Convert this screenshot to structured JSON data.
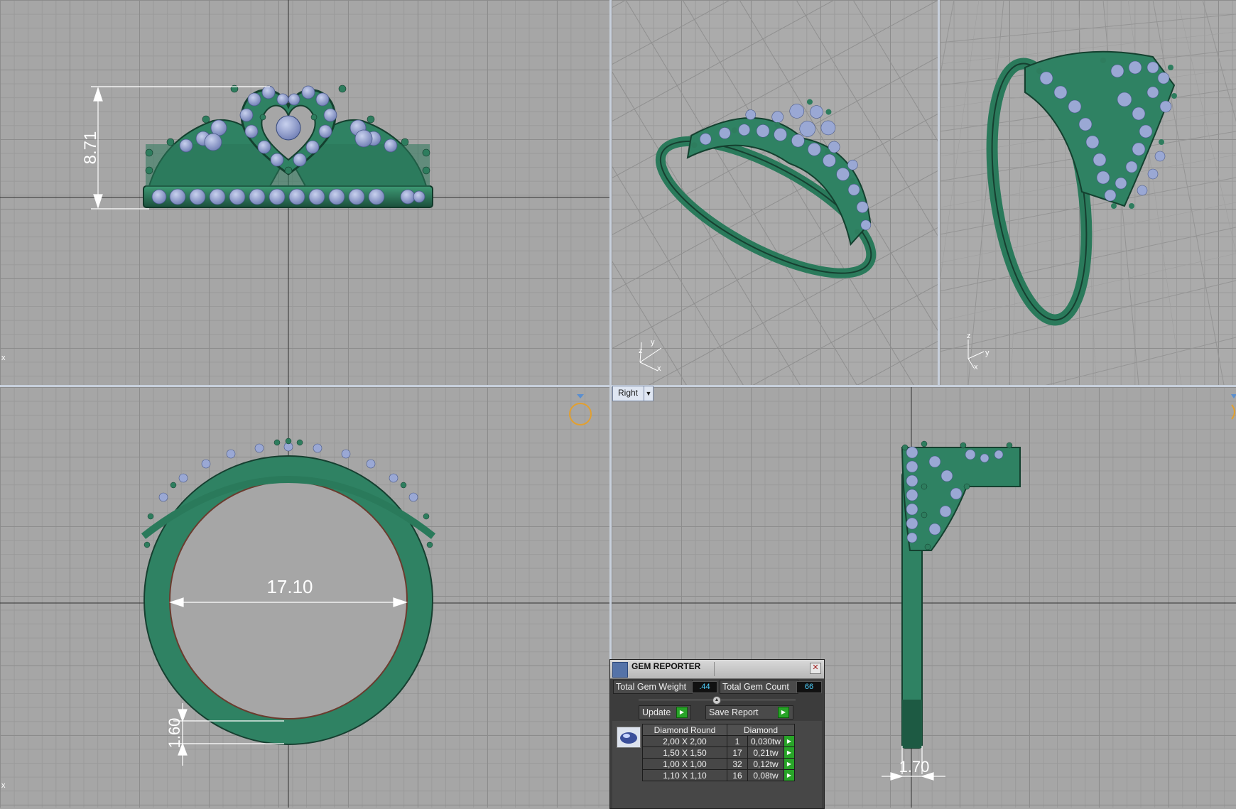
{
  "colors": {
    "metal": "#2f8263",
    "metal_dark": "#1d5a43",
    "gem": "#9aa8d4",
    "grid": "#a6a6a6"
  },
  "views": {
    "front": {
      "dimension": "8.71"
    },
    "top_iso": {
      "axes": {
        "x": "x",
        "y": "y",
        "z": "z"
      }
    },
    "top_iso2": {
      "axes": {
        "x": "x",
        "y": "y",
        "z": "z"
      }
    },
    "bottom_left": {
      "dimension_inner": "17.10",
      "dimension_band": "1.60"
    },
    "right": {
      "tab_label": "Right",
      "dimension": "1.70"
    },
    "axis_markers": {
      "x1": "x",
      "x2": "x"
    }
  },
  "gem_reporter": {
    "title": "GEM REPORTER",
    "total_weight_label": "Total Gem Weight",
    "total_weight_value": ".44",
    "total_count_label": "Total Gem Count",
    "total_count_value": "66",
    "update_label": "Update",
    "save_label": "Save Report",
    "columns": [
      "Diamond Round",
      "Diamond"
    ],
    "rows": [
      {
        "size": "2,00 X 2,00",
        "count": "1",
        "weight": "0,030tw"
      },
      {
        "size": "1,50 X 1,50",
        "count": "17",
        "weight": "0,21tw"
      },
      {
        "size": "1,00 X 1,00",
        "count": "32",
        "weight": "0,12tw"
      },
      {
        "size": "1,10 X 1,10",
        "count": "16",
        "weight": "0,08tw"
      }
    ]
  }
}
